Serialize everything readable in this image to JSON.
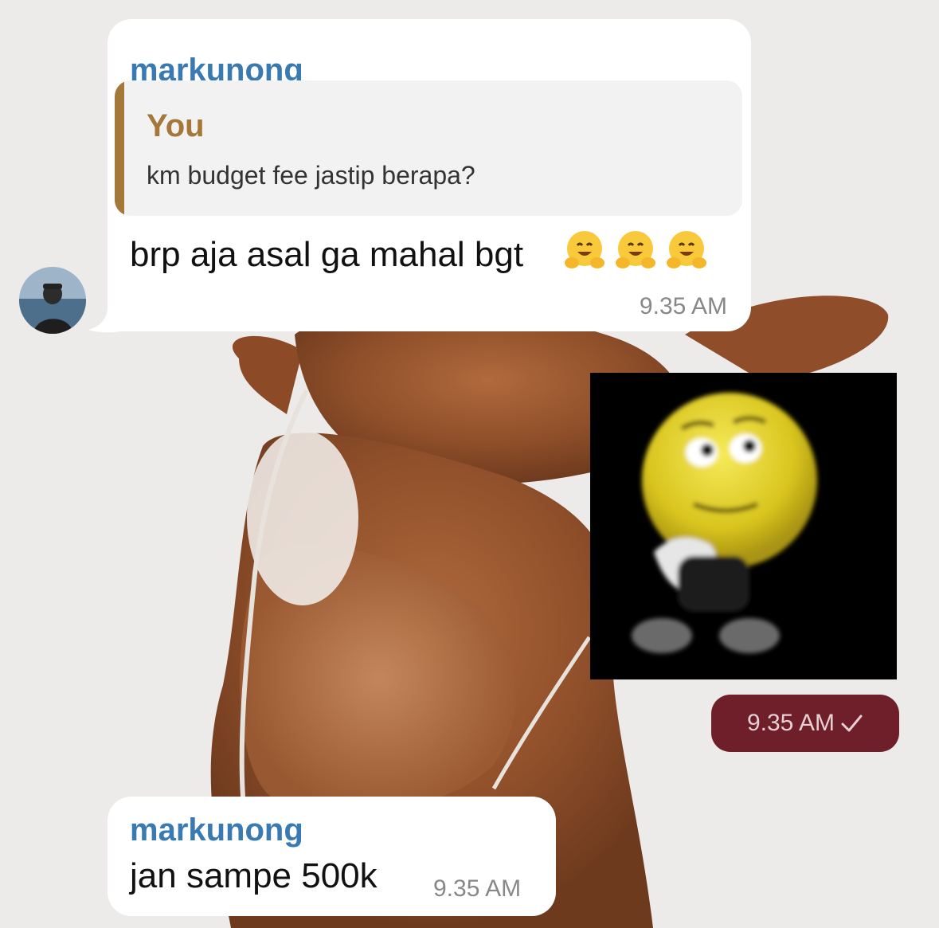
{
  "chat": {
    "wallpaper_icon": "dog-photo-wallpaper",
    "messages": [
      {
        "sender": "markunong",
        "reply": {
          "author": "You",
          "text": "km budget fee jastip berapa?"
        },
        "text": "brp aja asal ga mahal bgt",
        "emojis": [
          "🤗",
          "🤗",
          "🤗"
        ],
        "time": "9.35 AM"
      },
      {
        "type": "sticker",
        "sticker_icon": "thinking-emoji-sticker",
        "time": "9.35 AM",
        "status_icon": "check-icon",
        "outgoing": true
      },
      {
        "sender": "markunong",
        "text": "jan sampe 500k",
        "time": "9.35 AM"
      }
    ]
  },
  "colors": {
    "sender_name": "#3a7ab3",
    "reply_accent": "#a47839",
    "outgoing_bubble": "#6f1f2a"
  }
}
